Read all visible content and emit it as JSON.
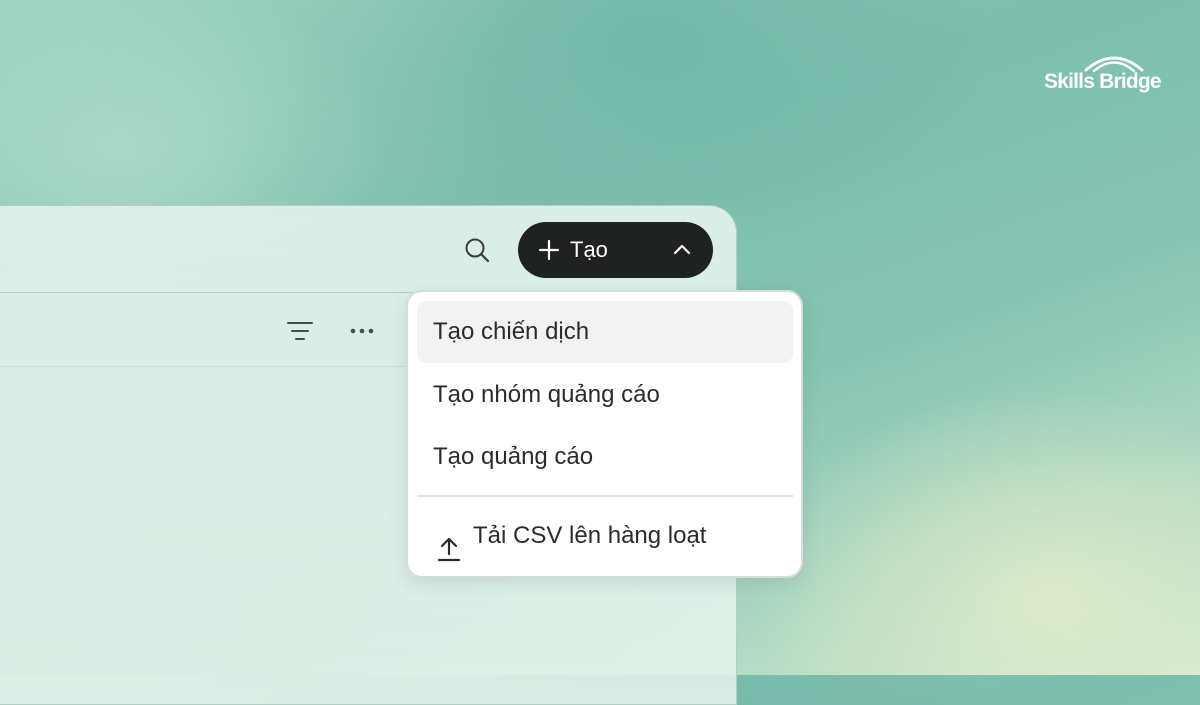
{
  "logo": {
    "text": "Skills Bridge"
  },
  "toolbar": {
    "search_icon": "search-icon",
    "create_button_label": "Tạo",
    "create_plus_icon": "plus-icon",
    "create_chevron_icon": "chevron-up-icon",
    "filter_icon": "filter-icon",
    "more_icon": "more-horizontal-icon"
  },
  "dropdown": {
    "items": [
      {
        "label": "Tạo chiến dịch",
        "highlighted": true
      },
      {
        "label": "Tạo nhóm quảng cáo",
        "highlighted": false
      },
      {
        "label": "Tạo quảng cáo",
        "highlighted": false
      }
    ],
    "upload_item": {
      "label": "Tải CSV lên hàng loạt",
      "icon": "upload-icon"
    }
  },
  "colors": {
    "button_background": "#202221",
    "button_text": "#ffffff",
    "menu_background": "#ffffff",
    "menu_highlight": "#f1f2f1",
    "text_primary": "#2a2c2b",
    "background_teal": "#7dbfae"
  }
}
